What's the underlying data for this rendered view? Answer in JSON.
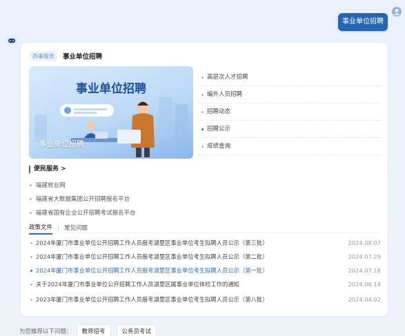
{
  "user_message": "事业单位招聘",
  "card": {
    "tag": "办事服务",
    "title": "事业单位招聘",
    "banner": {
      "heading": "事业单位招聘",
      "caption": "事业单位招聘"
    },
    "right_list": [
      {
        "label": "高层次人才招聘"
      },
      {
        "label": "编外人员招聘"
      },
      {
        "label": "招聘动态"
      },
      {
        "label": "招聘公示"
      },
      {
        "label": "成绩查询"
      }
    ],
    "service": {
      "title": "便民服务 >",
      "items": [
        {
          "label": "福建就业网"
        },
        {
          "label": "福建省大数据集团公开招聘报名平台"
        },
        {
          "label": "福建省国有企业公开招聘考试报名平台"
        }
      ]
    },
    "tabs": [
      {
        "label": "政策文件"
      },
      {
        "label": "常见问题"
      }
    ],
    "news": [
      {
        "title": "2024年厦门市事业单位公开招聘工作人员报考湖里区事业单位考生拟聘人员公示（第三批）",
        "date": "2024.08.07"
      },
      {
        "title": "2024年厦门市事业单位公开招聘工作人员报考湖里区事业单位考生拟聘人员公示（第二批）",
        "date": "2024.07.29"
      },
      {
        "title": "2024年厦门市事业单位公开招聘工作人员报考湖里区事业单位考生拟聘人员公示（第一批）",
        "date": "2024.07.18"
      },
      {
        "title": "关于2024年厦门市事业单位公开招聘工作人员湖里区属事业单位体检工作的通知",
        "date": "2024.06.14"
      },
      {
        "title": "2023年厦门市事业单位公开招聘工作人员报考湖里区事业单位考生拟聘人员公示（第八批）",
        "date": "2024.04.02"
      }
    ]
  },
  "suggestions": {
    "label": "为您推荐以下问题：",
    "chips": [
      {
        "label": "教师招考"
      },
      {
        "label": "公务员考试"
      }
    ]
  },
  "colors": {
    "accent": "#2d6bbf",
    "bubble": "#2366b4"
  }
}
